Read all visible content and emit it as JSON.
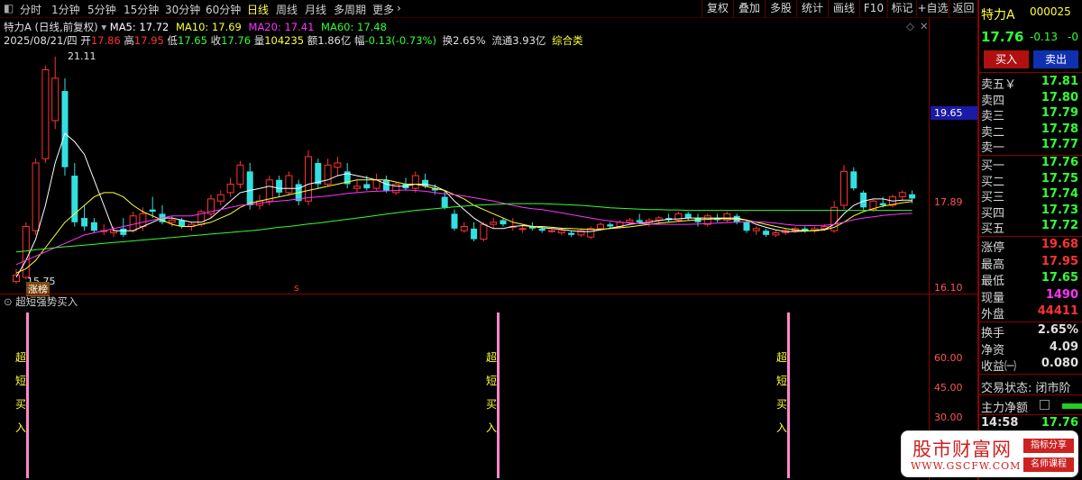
{
  "toolbar": {
    "left_items": [
      "分时",
      "1分钟",
      "5分钟",
      "15分钟",
      "30分钟",
      "60分钟",
      "日线",
      "周线",
      "月线",
      "多周期",
      "更多"
    ],
    "active": "日线",
    "right_buttons": [
      "复权",
      "叠加",
      "多股",
      "统计",
      "画线",
      "F10",
      "标记",
      "+自选",
      "返回"
    ]
  },
  "stock": {
    "title": "特力A",
    "mode": "(日线,前复权)",
    "ma": [
      {
        "label": "MA5: 17.72",
        "color": "#ffffff"
      },
      {
        "label": "MA10: 17.69",
        "color": "#ffff33"
      },
      {
        "label": "MA20: 17.41",
        "color": "#ff33ff"
      },
      {
        "label": "MA60: 17.48",
        "color": "#33ff33"
      }
    ]
  },
  "bar_info": {
    "date": "2025/08/21/四",
    "open_label": "开",
    "open": "17.86",
    "high_label": "高",
    "high": "17.95",
    "low_label": "低",
    "low": "17.65",
    "close_label": "收",
    "close": "17.76",
    "vol_label": "量",
    "vol": "104235",
    "amt_label": "额",
    "amt": "1.86亿",
    "range_label": "幅",
    "range": "-0.13(-0.73%)",
    "turnover": "换2.65%",
    "float": "流通3.93亿",
    "sector": "综合类"
  },
  "chart_annotations": {
    "high_mark": "21.11",
    "low_mark": "15.75",
    "limit_up_badge": "涨榜",
    "s_marker": "s"
  },
  "axis": {
    "price_tag": "19.65",
    "labels": [
      "17.89",
      "16.10"
    ],
    "ind_labels": [
      "60.00",
      "45.00",
      "30.00"
    ]
  },
  "indicator": {
    "name": "超短强势买入",
    "signal_text": [
      "超",
      "短",
      "买",
      "入"
    ]
  },
  "colors": {
    "up": "#ff3333",
    "down": "#33e0e0",
    "ma5": "#ffffff",
    "ma10": "#ffff33",
    "ma20": "#ff33ff",
    "ma60": "#33ff33",
    "signal": "#ff88cc"
  },
  "chart_data": [
    {
      "type": "candlestick",
      "series": [
        {
          "o": 15.8,
          "h": 16.1,
          "l": 15.75,
          "c": 15.95
        },
        {
          "o": 15.9,
          "h": 17.2,
          "l": 15.85,
          "c": 17.1
        },
        {
          "o": 17.0,
          "h": 18.7,
          "l": 16.9,
          "c": 18.6
        },
        {
          "o": 18.7,
          "h": 20.9,
          "l": 18.6,
          "c": 20.8
        },
        {
          "o": 19.6,
          "h": 21.11,
          "l": 19.4,
          "c": 20.6
        },
        {
          "o": 20.3,
          "h": 20.6,
          "l": 18.3,
          "c": 18.5
        },
        {
          "o": 18.3,
          "h": 18.6,
          "l": 17.1,
          "c": 17.2
        },
        {
          "o": 17.3,
          "h": 17.6,
          "l": 17.0,
          "c": 17.1
        },
        {
          "o": 17.2,
          "h": 17.3,
          "l": 16.95,
          "c": 17.0
        },
        {
          "o": 17.0,
          "h": 17.15,
          "l": 16.9,
          "c": 17.0
        },
        {
          "o": 16.95,
          "h": 17.1,
          "l": 16.85,
          "c": 17.0
        },
        {
          "o": 17.05,
          "h": 17.3,
          "l": 16.85,
          "c": 16.9
        },
        {
          "o": 17.0,
          "h": 17.45,
          "l": 16.95,
          "c": 17.35
        },
        {
          "o": 17.1,
          "h": 17.55,
          "l": 17.0,
          "c": 17.4
        },
        {
          "o": 17.5,
          "h": 17.8,
          "l": 17.3,
          "c": 17.45
        },
        {
          "o": 17.4,
          "h": 17.6,
          "l": 17.15,
          "c": 17.2
        },
        {
          "o": 17.2,
          "h": 17.35,
          "l": 17.1,
          "c": 17.25
        },
        {
          "o": 17.25,
          "h": 17.3,
          "l": 17.05,
          "c": 17.1
        },
        {
          "o": 17.1,
          "h": 17.2,
          "l": 17.0,
          "c": 17.15
        },
        {
          "o": 17.15,
          "h": 17.5,
          "l": 17.1,
          "c": 17.45
        },
        {
          "o": 17.4,
          "h": 17.85,
          "l": 17.3,
          "c": 17.75
        },
        {
          "o": 17.7,
          "h": 17.95,
          "l": 17.6,
          "c": 17.85
        },
        {
          "o": 17.9,
          "h": 18.25,
          "l": 17.8,
          "c": 18.1
        },
        {
          "o": 18.1,
          "h": 18.65,
          "l": 18.0,
          "c": 18.55
        },
        {
          "o": 18.4,
          "h": 18.6,
          "l": 17.5,
          "c": 17.6
        },
        {
          "o": 17.6,
          "h": 17.85,
          "l": 17.5,
          "c": 17.7
        },
        {
          "o": 17.7,
          "h": 18.3,
          "l": 17.6,
          "c": 18.2
        },
        {
          "o": 18.2,
          "h": 18.3,
          "l": 17.8,
          "c": 17.9
        },
        {
          "o": 17.9,
          "h": 18.4,
          "l": 17.85,
          "c": 18.3
        },
        {
          "o": 18.1,
          "h": 18.2,
          "l": 17.6,
          "c": 17.7
        },
        {
          "o": 17.7,
          "h": 18.9,
          "l": 17.6,
          "c": 18.75
        },
        {
          "o": 18.6,
          "h": 18.7,
          "l": 18.0,
          "c": 18.1
        },
        {
          "o": 18.1,
          "h": 18.7,
          "l": 18.05,
          "c": 18.55
        },
        {
          "o": 18.5,
          "h": 18.75,
          "l": 18.3,
          "c": 18.6
        },
        {
          "o": 18.4,
          "h": 18.6,
          "l": 18.0,
          "c": 18.1
        },
        {
          "o": 18.0,
          "h": 18.2,
          "l": 17.9,
          "c": 18.05
        },
        {
          "o": 18.1,
          "h": 18.3,
          "l": 17.95,
          "c": 18.0
        },
        {
          "o": 18.0,
          "h": 18.35,
          "l": 17.95,
          "c": 18.2
        },
        {
          "o": 18.2,
          "h": 18.3,
          "l": 17.9,
          "c": 17.95
        },
        {
          "o": 17.9,
          "h": 18.15,
          "l": 17.85,
          "c": 18.1
        },
        {
          "o": 18.1,
          "h": 18.25,
          "l": 17.95,
          "c": 18.0
        },
        {
          "o": 18.0,
          "h": 18.4,
          "l": 17.9,
          "c": 18.3
        },
        {
          "o": 18.2,
          "h": 18.35,
          "l": 18.0,
          "c": 18.05
        },
        {
          "o": 18.0,
          "h": 18.1,
          "l": 17.85,
          "c": 17.95
        },
        {
          "o": 17.8,
          "h": 17.95,
          "l": 17.5,
          "c": 17.55
        },
        {
          "o": 17.4,
          "h": 17.5,
          "l": 17.0,
          "c": 17.05
        },
        {
          "o": 17.0,
          "h": 17.2,
          "l": 16.95,
          "c": 17.1
        },
        {
          "o": 17.05,
          "h": 17.2,
          "l": 16.75,
          "c": 16.8
        },
        {
          "o": 16.8,
          "h": 17.2,
          "l": 16.75,
          "c": 17.15
        },
        {
          "o": 17.15,
          "h": 17.3,
          "l": 17.05,
          "c": 17.2
        },
        {
          "o": 17.25,
          "h": 17.3,
          "l": 17.1,
          "c": 17.15
        },
        {
          "o": 17.1,
          "h": 17.3,
          "l": 17.0,
          "c": 17.1
        },
        {
          "o": 17.05,
          "h": 17.15,
          "l": 16.95,
          "c": 17.05
        },
        {
          "o": 17.1,
          "h": 17.2,
          "l": 17.0,
          "c": 17.05
        },
        {
          "o": 17.05,
          "h": 17.1,
          "l": 16.95,
          "c": 17.0
        },
        {
          "o": 17.0,
          "h": 17.05,
          "l": 16.95,
          "c": 17.0
        },
        {
          "o": 16.95,
          "h": 17.05,
          "l": 16.9,
          "c": 17.0
        },
        {
          "o": 16.95,
          "h": 17.0,
          "l": 16.85,
          "c": 16.9
        },
        {
          "o": 16.9,
          "h": 17.05,
          "l": 16.85,
          "c": 17.0
        },
        {
          "o": 16.85,
          "h": 17.1,
          "l": 16.8,
          "c": 17.05
        },
        {
          "o": 17.05,
          "h": 17.2,
          "l": 17.0,
          "c": 17.15
        },
        {
          "o": 17.15,
          "h": 17.2,
          "l": 17.05,
          "c": 17.1
        },
        {
          "o": 17.1,
          "h": 17.25,
          "l": 17.05,
          "c": 17.2
        },
        {
          "o": 17.2,
          "h": 17.3,
          "l": 17.15,
          "c": 17.25
        },
        {
          "o": 17.25,
          "h": 17.4,
          "l": 17.15,
          "c": 17.2
        },
        {
          "o": 17.2,
          "h": 17.3,
          "l": 17.1,
          "c": 17.25
        },
        {
          "o": 17.25,
          "h": 17.35,
          "l": 17.15,
          "c": 17.3
        },
        {
          "o": 17.3,
          "h": 17.4,
          "l": 17.2,
          "c": 17.25
        },
        {
          "o": 17.25,
          "h": 17.45,
          "l": 17.2,
          "c": 17.4
        },
        {
          "o": 17.4,
          "h": 17.45,
          "l": 17.25,
          "c": 17.3
        },
        {
          "o": 17.3,
          "h": 17.4,
          "l": 17.1,
          "c": 17.2
        },
        {
          "o": 17.15,
          "h": 17.4,
          "l": 17.1,
          "c": 17.35
        },
        {
          "o": 17.3,
          "h": 17.4,
          "l": 17.2,
          "c": 17.25
        },
        {
          "o": 17.25,
          "h": 17.45,
          "l": 17.2,
          "c": 17.4
        },
        {
          "o": 17.35,
          "h": 17.4,
          "l": 17.15,
          "c": 17.2
        },
        {
          "o": 17.2,
          "h": 17.25,
          "l": 16.95,
          "c": 17.0
        },
        {
          "o": 17.0,
          "h": 17.1,
          "l": 16.9,
          "c": 17.05
        },
        {
          "o": 17.0,
          "h": 17.05,
          "l": 16.85,
          "c": 16.9
        },
        {
          "o": 16.9,
          "h": 17.0,
          "l": 16.85,
          "c": 16.95
        },
        {
          "o": 16.95,
          "h": 17.05,
          "l": 16.9,
          "c": 17.0
        },
        {
          "o": 17.0,
          "h": 17.1,
          "l": 16.95,
          "c": 17.05
        },
        {
          "o": 17.05,
          "h": 17.1,
          "l": 16.95,
          "c": 17.0
        },
        {
          "o": 17.0,
          "h": 17.1,
          "l": 16.95,
          "c": 17.05
        },
        {
          "o": 17.05,
          "h": 17.15,
          "l": 17.0,
          "c": 17.1
        },
        {
          "o": 17.0,
          "h": 17.7,
          "l": 16.95,
          "c": 17.55
        },
        {
          "o": 17.6,
          "h": 18.55,
          "l": 17.5,
          "c": 18.4
        },
        {
          "o": 18.4,
          "h": 18.5,
          "l": 17.95,
          "c": 18.0
        },
        {
          "o": 17.9,
          "h": 17.95,
          "l": 17.5,
          "c": 17.55
        },
        {
          "o": 17.5,
          "h": 17.75,
          "l": 17.45,
          "c": 17.7
        },
        {
          "o": 17.65,
          "h": 17.8,
          "l": 17.55,
          "c": 17.6
        },
        {
          "o": 17.6,
          "h": 17.85,
          "l": 17.55,
          "c": 17.8
        },
        {
          "o": 17.8,
          "h": 17.95,
          "l": 17.7,
          "c": 17.9
        },
        {
          "o": 17.86,
          "h": 17.95,
          "l": 17.65,
          "c": 17.76
        }
      ],
      "ma5": [
        15.9,
        16.3,
        16.8,
        17.6,
        18.6,
        19.3,
        19.1,
        18.8,
        18.2,
        17.6,
        17.0,
        17.0,
        17.0,
        17.1,
        17.2,
        17.3,
        17.3,
        17.25,
        17.2,
        17.2,
        17.3,
        17.5,
        17.7,
        17.9,
        17.95,
        18.0,
        18.05,
        18.0,
        18.0,
        18.0,
        18.1,
        18.15,
        18.2,
        18.3,
        18.35,
        18.3,
        18.25,
        18.2,
        18.1,
        18.05,
        18.05,
        18.1,
        18.1,
        18.05,
        17.95,
        17.7,
        17.5,
        17.3,
        17.15,
        17.05,
        17.05,
        17.1,
        17.12,
        17.1,
        17.07,
        17.05,
        17.03,
        17.0,
        16.98,
        16.98,
        17.02,
        17.06,
        17.1,
        17.15,
        17.18,
        17.2,
        17.24,
        17.27,
        17.28,
        17.3,
        17.3,
        17.3,
        17.3,
        17.3,
        17.3,
        17.25,
        17.15,
        17.08,
        17.02,
        16.98,
        16.98,
        16.99,
        17.01,
        17.03,
        17.15,
        17.4,
        17.6,
        17.7,
        17.75,
        17.75,
        17.7,
        17.72,
        17.72
      ],
      "ma10": [
        16.0,
        16.1,
        16.3,
        16.6,
        16.9,
        17.2,
        17.4,
        17.6,
        17.8,
        17.9,
        17.9,
        17.8,
        17.6,
        17.45,
        17.35,
        17.25,
        17.15,
        17.1,
        17.1,
        17.15,
        17.2,
        17.3,
        17.4,
        17.55,
        17.65,
        17.7,
        17.75,
        17.8,
        17.85,
        17.9,
        17.95,
        18.0,
        18.05,
        18.1,
        18.15,
        18.2,
        18.2,
        18.2,
        18.2,
        18.15,
        18.1,
        18.1,
        18.05,
        18.0,
        17.95,
        17.85,
        17.75,
        17.6,
        17.5,
        17.4,
        17.3,
        17.2,
        17.15,
        17.1,
        17.1,
        17.08,
        17.06,
        17.05,
        17.04,
        17.03,
        17.03,
        17.05,
        17.07,
        17.09,
        17.12,
        17.15,
        17.18,
        17.2,
        17.22,
        17.24,
        17.26,
        17.27,
        17.28,
        17.28,
        17.27,
        17.25,
        17.2,
        17.15,
        17.1,
        17.05,
        17.02,
        17.0,
        17.0,
        17.02,
        17.08,
        17.2,
        17.35,
        17.45,
        17.52,
        17.58,
        17.62,
        17.66,
        17.69
      ],
      "ma20": [
        16.2,
        16.3,
        16.4,
        16.5,
        16.6,
        16.7,
        16.8,
        16.9,
        16.95,
        17.0,
        17.05,
        17.1,
        17.15,
        17.2,
        17.25,
        17.3,
        17.35,
        17.35,
        17.35,
        17.4,
        17.45,
        17.5,
        17.55,
        17.6,
        17.62,
        17.65,
        17.68,
        17.7,
        17.72,
        17.75,
        17.78,
        17.8,
        17.82,
        17.85,
        17.88,
        17.9,
        17.92,
        17.93,
        17.94,
        17.95,
        17.96,
        17.95,
        17.93,
        17.9,
        17.87,
        17.85,
        17.82,
        17.78,
        17.74,
        17.7,
        17.65,
        17.6,
        17.55,
        17.52,
        17.5,
        17.46,
        17.42,
        17.38,
        17.34,
        17.3,
        17.26,
        17.23,
        17.2,
        17.18,
        17.17,
        17.16,
        17.15,
        17.15,
        17.15,
        17.15,
        17.16,
        17.17,
        17.18,
        17.19,
        17.2,
        17.21,
        17.21,
        17.2,
        17.18,
        17.15,
        17.13,
        17.12,
        17.12,
        17.13,
        17.15,
        17.2,
        17.26,
        17.3,
        17.33,
        17.36,
        17.38,
        17.4,
        17.41
      ],
      "ma60": [
        16.5,
        16.52,
        16.55,
        16.57,
        16.6,
        16.62,
        16.64,
        16.66,
        16.68,
        16.7,
        16.72,
        16.74,
        16.76,
        16.78,
        16.8,
        16.82,
        16.84,
        16.86,
        16.88,
        16.9,
        16.92,
        16.94,
        16.96,
        16.98,
        17.0,
        17.02,
        17.05,
        17.08,
        17.1,
        17.13,
        17.16,
        17.18,
        17.21,
        17.24,
        17.27,
        17.3,
        17.33,
        17.36,
        17.39,
        17.42,
        17.45,
        17.48,
        17.5,
        17.52,
        17.54,
        17.56,
        17.58,
        17.6,
        17.61,
        17.62,
        17.63,
        17.64,
        17.64,
        17.64,
        17.64,
        17.63,
        17.62,
        17.61,
        17.6,
        17.58,
        17.56,
        17.54,
        17.53,
        17.52,
        17.51,
        17.5,
        17.5,
        17.49,
        17.49,
        17.48,
        17.48,
        17.48,
        17.48,
        17.48,
        17.48,
        17.48,
        17.48,
        17.48,
        17.48,
        17.48,
        17.48,
        17.48,
        17.48,
        17.48,
        17.48,
        17.48,
        17.48,
        17.48,
        17.48,
        17.48,
        17.48,
        17.48,
        17.48
      ],
      "ylim": [
        15.6,
        21.3
      ]
    }
  ],
  "right_panel": {
    "name": "特力A",
    "code": "000025",
    "price": "17.76",
    "change": "-0.13",
    "change_pct": "-0",
    "buy_btn": "买入",
    "sell_btn": "卖出",
    "asks": [
      {
        "label": "卖五￥",
        "price": "17.81"
      },
      {
        "label": "卖四",
        "price": "17.80"
      },
      {
        "label": "卖三",
        "price": "17.79"
      },
      {
        "label": "卖二",
        "price": "17.78"
      },
      {
        "label": "卖一",
        "price": "17.77"
      }
    ],
    "bids": [
      {
        "label": "买一",
        "price": "17.76"
      },
      {
        "label": "买二",
        "price": "17.75"
      },
      {
        "label": "买三",
        "price": "17.74"
      },
      {
        "label": "买四",
        "price": "17.73"
      },
      {
        "label": "买五",
        "price": "17.72"
      }
    ],
    "stats": [
      {
        "label": "涨停",
        "value": "19.68",
        "color": "#ff3333"
      },
      {
        "label": "最高",
        "value": "17.95",
        "color": "#ff3333"
      },
      {
        "label": "最低",
        "value": "17.65",
        "color": "#33ff33"
      },
      {
        "label": "现量",
        "value": "1490",
        "color": "#ff33ff"
      },
      {
        "label": "外盘",
        "value": "44411",
        "color": "#ff3333"
      }
    ],
    "stats2": [
      {
        "label": "换手",
        "value": "2.65%",
        "color": "#e0e0e0"
      },
      {
        "label": "净资",
        "value": "4.09",
        "color": "#e0e0e0"
      },
      {
        "label": "收益㈠",
        "value": "0.080",
        "color": "#e0e0e0"
      }
    ],
    "trade_status": "交易状态: 闭市阶",
    "net_label": "主力净额",
    "last_time": "14:58",
    "last_price": "17.76"
  },
  "watermark": {
    "title": "股市财富网",
    "url": "WWW.GSCFW.COM",
    "tag1": "指标分享",
    "tag2": "名师课程"
  }
}
